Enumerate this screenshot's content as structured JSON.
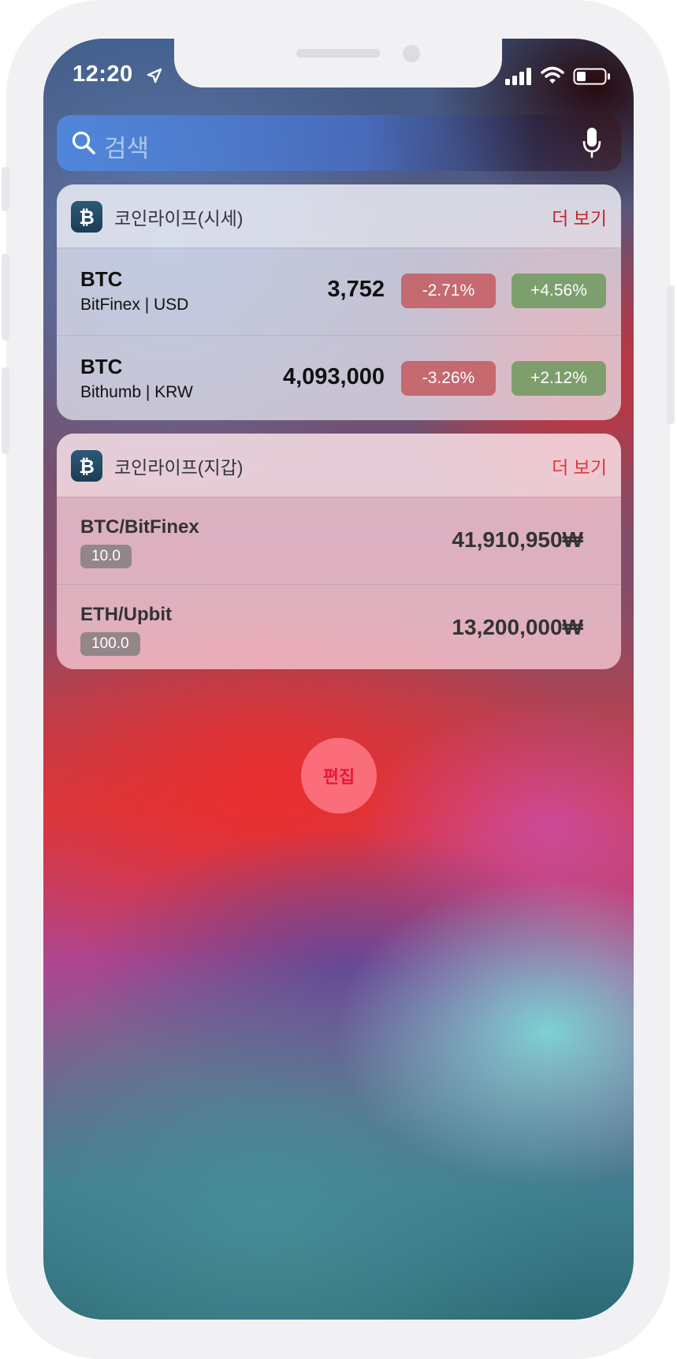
{
  "status_bar": {
    "time": "12:20"
  },
  "search": {
    "placeholder": "검색"
  },
  "price_widget": {
    "title": "코인라이프(시세)",
    "more_label": "더 보기",
    "rows": [
      {
        "symbol": "BTC",
        "exchange": "BitFinex | USD",
        "price": "3,752",
        "change_a": "-2.71%",
        "change_b": "+4.56%"
      },
      {
        "symbol": "BTC",
        "exchange": "Bithumb | KRW",
        "price": "4,093,000",
        "change_a": "-3.26%",
        "change_b": "+2.12%"
      }
    ]
  },
  "wallet_widget": {
    "title": "코인라이프(지갑)",
    "more_label": "더 보기",
    "rows": [
      {
        "name": "BTC/BitFinex",
        "amount": "10.0",
        "value": "41,910,950₩"
      },
      {
        "name": "ETH/Upbit",
        "amount": "100.0",
        "value": "13,200,000₩"
      }
    ]
  },
  "edit_button": {
    "label": "편집"
  },
  "colors": {
    "negative": "#c35a5f",
    "positive": "#739b64",
    "accent_red": "#c4232d"
  },
  "icons": [
    "location-arrow-icon",
    "signal-icon",
    "wifi-icon",
    "battery-icon",
    "search-icon",
    "microphone-icon",
    "bitcoin-icon"
  ]
}
